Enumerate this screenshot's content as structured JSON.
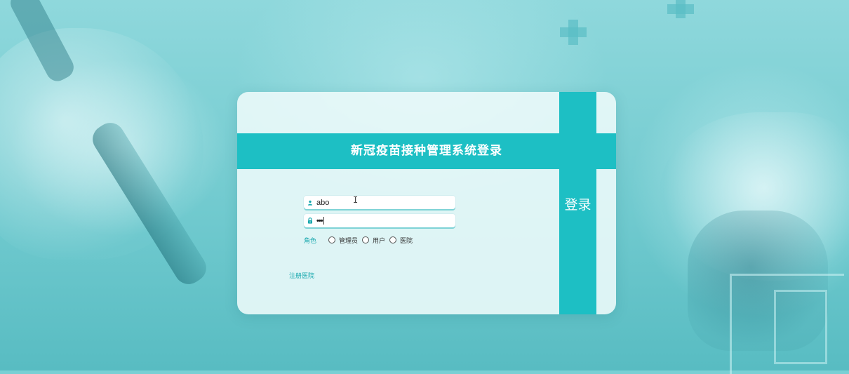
{
  "page": {
    "title": "新冠疫苗接种管理系统登录",
    "login_button": "登录"
  },
  "form": {
    "username": {
      "value": "abo",
      "icon": "user-icon"
    },
    "password": {
      "value": "•••",
      "icon": "lock-icon"
    },
    "role": {
      "label": "角色",
      "options": [
        "管理员",
        "用户",
        "医院"
      ]
    },
    "register_link": "注册医院"
  },
  "colors": {
    "accent": "#1dbfc4",
    "accent_text": "#19a8ae",
    "card_background": "#eefafb"
  }
}
